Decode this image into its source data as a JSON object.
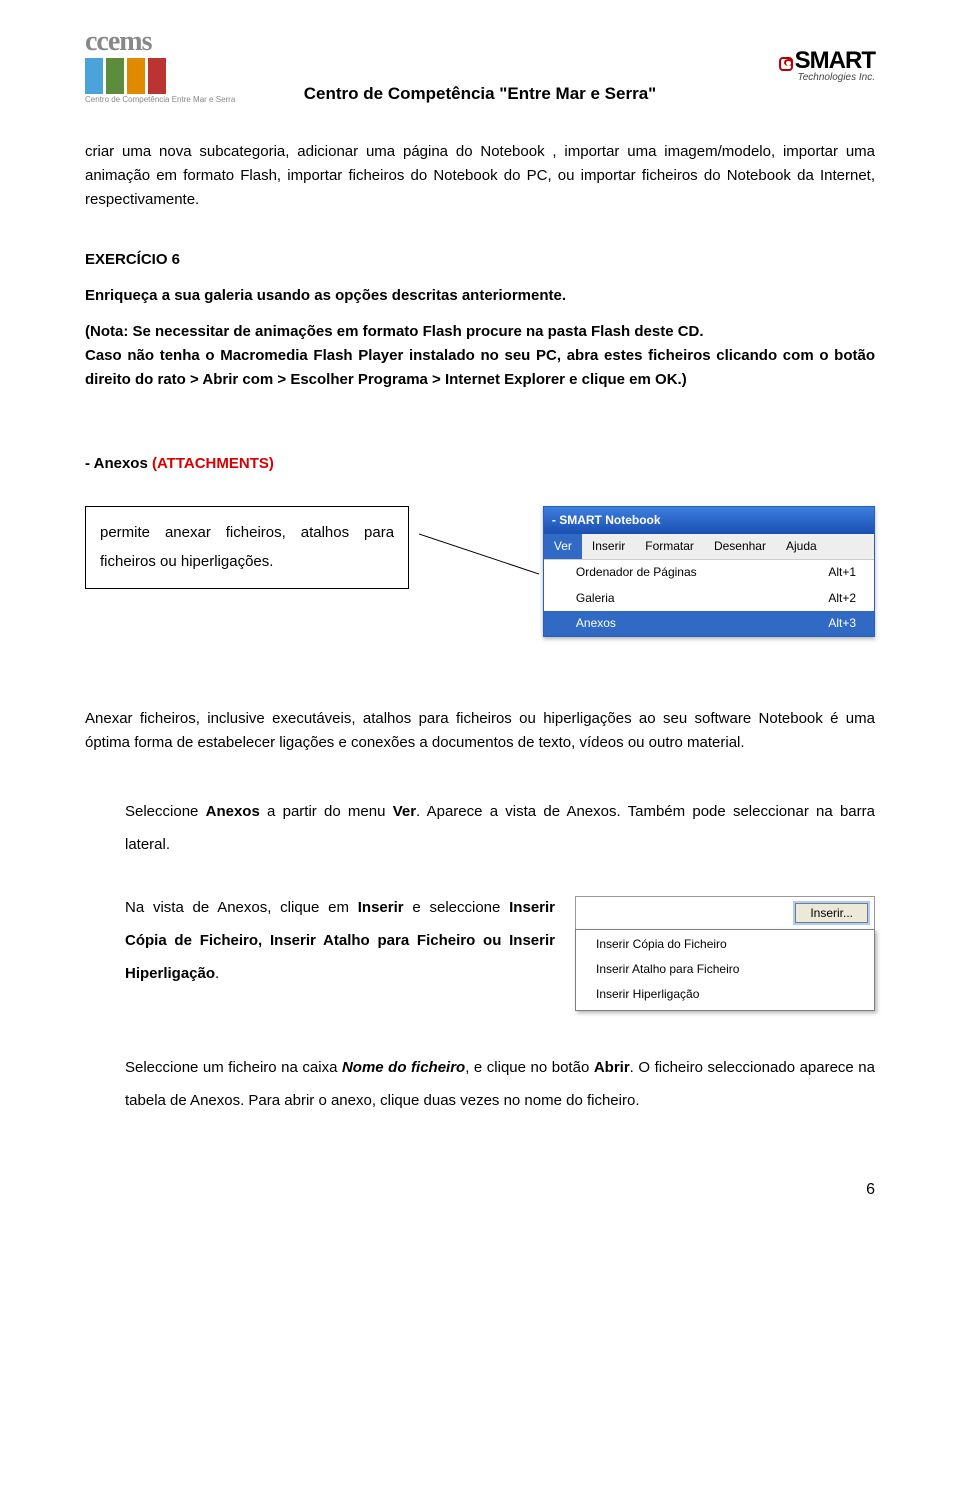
{
  "header": {
    "logo_text": "ccems",
    "logo_sub": "Centro de Competência Entre Mar e Serra",
    "title": "Centro de Competência \"Entre Mar e Serra\"",
    "smart_brand": "SMART",
    "smart_sub": "Technologies Inc."
  },
  "body": {
    "intro": "criar uma nova subcategoria, adicionar uma página do Notebook , importar uma imagem/modelo, importar uma animação em formato Flash, importar ficheiros do Notebook do PC, ou importar ficheiros do Notebook da Internet, respectivamente.",
    "ex_title": "EXERCÍCIO 6",
    "ex_text": "Enriqueça a sua galeria usando as opções descritas anteriormente.",
    "note1": "(Nota: Se necessitar de animações em formato Flash procure na pasta Flash deste CD.",
    "note2": "Caso não tenha o Macromedia Flash Player instalado no seu PC, abra estes ficheiros clicando com o botão direito do rato > Abrir com > Escolher Programa > Internet Explorer e clique em OK.)",
    "anexos_label": "- Anexos  ",
    "anexos_red": "(ATTACHMENTS)",
    "callout": "permite anexar ficheiros, atalhos para ficheiros ou hiperligações.",
    "para2": "Anexar ficheiros, inclusive executáveis, atalhos para ficheiros ou hiperligações ao seu software Notebook é uma óptima forma de estabelecer ligações e conexões a documentos de texto, vídeos ou outro material.",
    "instr1_a": "Seleccione ",
    "instr1_b": "Anexos",
    "instr1_c": " a partir do menu ",
    "instr1_d": "Ver",
    "instr1_e": ". Aparece a vista de Anexos. Também pode seleccionar na barra lateral.",
    "instr2_a": "Na vista de Anexos, clique em ",
    "instr2_b": "Inserir",
    "instr2_c": " e seleccione ",
    "instr2_d": "Inserir Cópia de Ficheiro, Inserir Atalho para Ficheiro ou Inserir Hiperligação",
    "instr2_e": ".",
    "instr3_a": "Seleccione um ficheiro na caixa ",
    "instr3_b": "Nome do ficheiro",
    "instr3_c": ", e clique no botão ",
    "instr3_d": "Abrir",
    "instr3_e": ". O ficheiro seleccionado aparece na tabela de Anexos. Para abrir o anexo, clique duas vezes no nome do ficheiro."
  },
  "menu": {
    "titlebar": "- SMART Notebook",
    "bar": [
      "Ver",
      "Inserir",
      "Formatar",
      "Desenhar",
      "Ajuda"
    ],
    "items": [
      {
        "label": "Ordenador de Páginas",
        "shortcut": "Alt+1"
      },
      {
        "label": "Galeria",
        "shortcut": "Alt+2"
      },
      {
        "label": "Anexos",
        "shortcut": "Alt+3"
      }
    ]
  },
  "inserir": {
    "button": "Inserir...",
    "items": [
      "Inserir Cópia do Ficheiro",
      "Inserir Atalho para Ficheiro",
      "Inserir Hiperligação"
    ]
  },
  "page_number": "6"
}
